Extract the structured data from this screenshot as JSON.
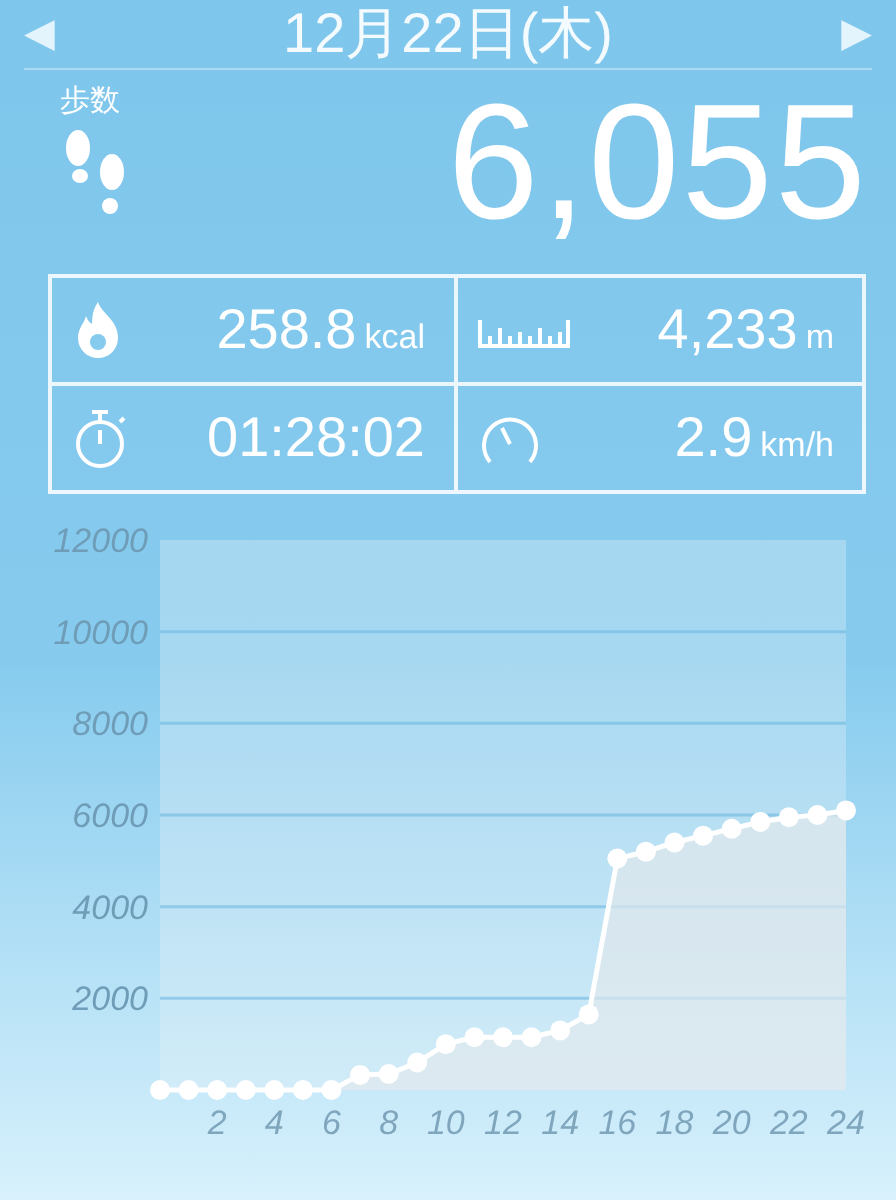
{
  "header": {
    "prev": "◀",
    "date": "12月22日(木)",
    "next": "▶"
  },
  "steps": {
    "label": "歩数",
    "value": "6,055"
  },
  "stats": [
    {
      "kind": "calories",
      "value": "258.8",
      "unit": "kcal"
    },
    {
      "kind": "distance",
      "value": "4,233",
      "unit": "m"
    },
    {
      "kind": "time",
      "value": "01:28:02"
    },
    {
      "kind": "speed",
      "value": "2.9",
      "unit": "km/h"
    }
  ],
  "chart_data": {
    "type": "area",
    "x": [
      0,
      1,
      2,
      3,
      4,
      5,
      6,
      7,
      8,
      9,
      10,
      11,
      12,
      13,
      14,
      15,
      16,
      17,
      18,
      19,
      20,
      21,
      22,
      23,
      24
    ],
    "grid": true,
    "series": [
      {
        "color": "#ffffff",
        "values": [
          0,
          0,
          0,
          0,
          0,
          0,
          0,
          330,
          350,
          600,
          1000,
          1150,
          1150,
          1150,
          1300,
          1650,
          5050,
          5200,
          5400,
          5550,
          5700,
          5850,
          5950,
          6000,
          6100
        ]
      }
    ],
    "xlim": [
      0,
      24
    ],
    "ylim": [
      0,
      12000
    ],
    "xticks": [
      2,
      4,
      6,
      8,
      10,
      12,
      14,
      16,
      18,
      20,
      22,
      24
    ],
    "yticks": [
      2000,
      4000,
      6000,
      8000,
      10000,
      12000
    ]
  }
}
